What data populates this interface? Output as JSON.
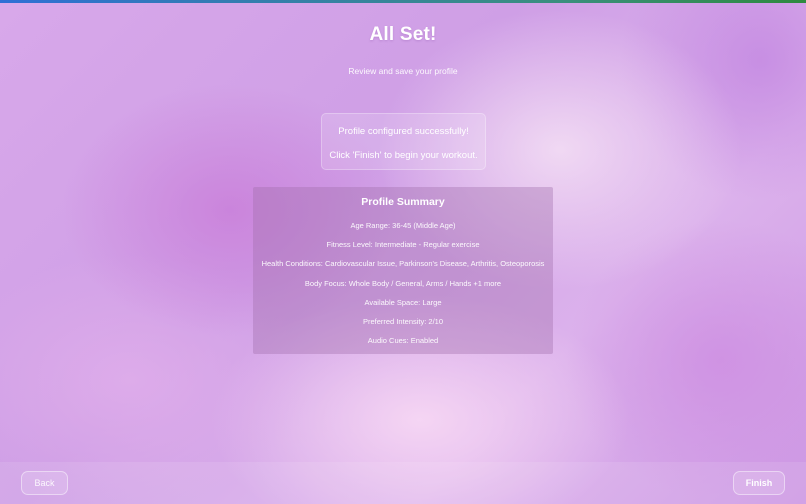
{
  "page": {
    "title": "All Set!",
    "subtitle": "Review and save your profile"
  },
  "success": {
    "message": "Profile configured successfully!",
    "instruction": "Click 'Finish' to begin your workout."
  },
  "summary": {
    "title": "Profile Summary",
    "rows": [
      "Age Range: 36-45 (Middle Age)",
      "Fitness Level: Intermediate - Regular exercise",
      "Health Conditions: Cardiovascular Issue, Parkinson's Disease, Arthritis, Osteoporosis",
      "Body Focus: Whole Body / General, Arms / Hands +1 more",
      "Available Space: Large",
      "Preferred Intensity: 2/10",
      "Audio Cues: Enabled"
    ]
  },
  "footer": {
    "back_label": "Back",
    "finish_label": "Finish"
  },
  "colors": {
    "top_strip_start": "#2f6fd6",
    "top_strip_end": "#2e8a3f",
    "background": "#d8a8ea"
  }
}
